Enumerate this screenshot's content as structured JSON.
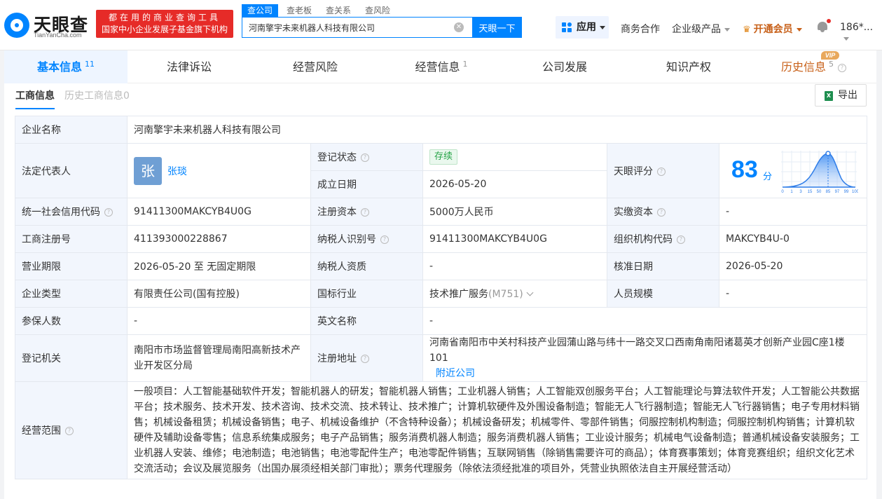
{
  "header": {
    "logo_text": "天眼查",
    "logo_sub": "TianYanCha.com",
    "slogan_line1": "都在用的商业查询工具",
    "slogan_line2": "国家中小企业发展子基金旗下机构",
    "search_tabs": [
      "查公司",
      "查老板",
      "查关系",
      "查风险"
    ],
    "search_value": "河南擎宇未来机器人科技有限公司",
    "search_button": "天眼一下",
    "app_button": "应用",
    "nav_business": "商务合作",
    "nav_products": "企业级产品",
    "nav_vip": "开通会员",
    "nav_user": "186*..."
  },
  "tabs": [
    {
      "label": "基本信息",
      "count": "11"
    },
    {
      "label": "法律诉讼",
      "count": ""
    },
    {
      "label": "经营风险",
      "count": ""
    },
    {
      "label": "经营信息",
      "count": "1"
    },
    {
      "label": "公司发展",
      "count": ""
    },
    {
      "label": "知识产权",
      "count": ""
    },
    {
      "label": "历史信息",
      "count": "5"
    }
  ],
  "vip_badge": "VIP",
  "sub_tabs": {
    "active": "工商信息",
    "inactive": "历史工商信息0"
  },
  "export_label": "导出",
  "info": {
    "name_label": "企业名称",
    "name_value": "河南擎宇未来机器人科技有限公司",
    "legal_label": "法定代表人",
    "legal_avatar": "张",
    "legal_name": "张琰",
    "status_label": "登记状态",
    "status_value": "存续",
    "founded_label": "成立日期",
    "founded_value": "2026-05-20",
    "score_label": "天眼评分",
    "score_value": "83",
    "score_unit": "分",
    "score_ticks": [
      "0",
      "1",
      "3",
      "15",
      "50",
      "85",
      "97",
      "99",
      "100"
    ],
    "credit_label": "统一社会信用代码",
    "credit_value": "91411300MAKCYB4U0G",
    "capital_label": "注册资本",
    "capital_value": "5000万人民币",
    "paid_label": "实缴资本",
    "paid_value": "-",
    "regno_label": "工商注册号",
    "regno_value": "411393000228867",
    "taxid_label": "纳税人识别号",
    "taxid_value": "91411300MAKCYB4U0G",
    "orgcode_label": "组织机构代码",
    "orgcode_value": "MAKCYB4U-0",
    "term_label": "营业期限",
    "term_value": "2026-05-20 至 无固定期限",
    "taxq_label": "纳税人资质",
    "taxq_value": "-",
    "approve_label": "核准日期",
    "approve_value": "2026-05-20",
    "type_label": "企业类型",
    "type_value": "有限责任公司(国有控股)",
    "industry_label": "国标行业",
    "industry_value": "技术推广服务",
    "industry_code": "(M751)",
    "staff_label": "人员规模",
    "staff_value": "-",
    "insured_label": "参保人数",
    "insured_value": "-",
    "english_label": "英文名称",
    "english_value": "-",
    "authority_label": "登记机关",
    "authority_value": "南阳市市场监督管理局南阳高新技术产业开发区分局",
    "address_label": "注册地址",
    "address_value": "河南省南阳市中关村科技产业园蒲山路与纬十一路交叉口西南角南阳诸葛英才创新产业园C座1楼101",
    "nearby_link": "附近公司",
    "scope_label": "经营范围",
    "scope_value": "一般项目：人工智能基础软件开发；智能机器人的研发；智能机器人销售；工业机器人销售；人工智能双创服务平台；人工智能理论与算法软件开发；人工智能公共数据平台；技术服务、技术开发、技术咨询、技术交流、技术转让、技术推广；计算机软硬件及外围设备制造；智能无人飞行器制造；智能无人飞行器销售；电子专用材料销售；机械设备租赁；机械设备销售；电子、机械设备维护（不含特种设备）；机械设备研发；机械零件、零部件销售；伺服控制机构制造；伺服控制机构销售；计算机软硬件及辅助设备零售；信息系统集成服务；电子产品销售；服务消费机器人制造；服务消费机器人销售；工业设计服务；机械电气设备制造；普通机械设备安装服务；工业机器人安装、维修；电池制造；电池销售；电池零配件生产；电池零配件销售；互联网销售（除销售需要许可的商品）；体育赛事策划；体育竞赛组织；组织文化艺术交流活动；会议及展览服务（出国办展须经相关部门审批）；票务代理服务（除依法须经批准的项目外，凭营业执照依法自主开展经营活动）"
  },
  "colors": {
    "accent": "#0084ff",
    "brand_red": "#e62b28",
    "vip_orange": "#c8611a",
    "label_bg": "#f2f6fd",
    "status_green": "#27a448"
  }
}
